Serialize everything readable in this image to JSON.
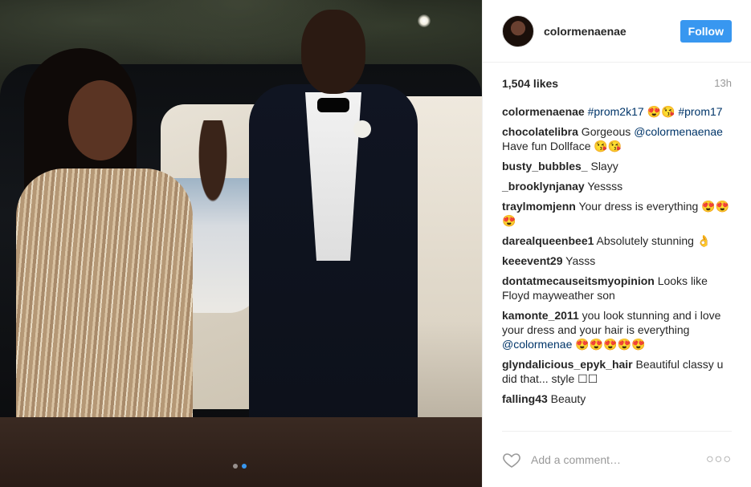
{
  "post": {
    "username": "colormenaenae",
    "follow_label": "Follow",
    "likes": "1,504 likes",
    "time": "13h",
    "carousel": {
      "count": 2,
      "active": 1
    }
  },
  "comments": [
    {
      "user": "colormenaenae",
      "parts": [
        {
          "t": " "
        },
        {
          "t": "#prom2k17",
          "tag": true
        },
        {
          "t": " 😍😘 "
        },
        {
          "t": "#prom17",
          "tag": true
        }
      ]
    },
    {
      "user": "chocolatelibra",
      "parts": [
        {
          "t": " Gorgeous "
        },
        {
          "t": "@colormenaenae",
          "tag": true
        },
        {
          "t": " Have fun Dollface 😘😘"
        }
      ]
    },
    {
      "user": "busty_bubbles_",
      "parts": [
        {
          "t": " Slayy"
        }
      ]
    },
    {
      "user": "_brooklynjanay",
      "parts": [
        {
          "t": " Yessss"
        }
      ]
    },
    {
      "user": "traylmomjenn",
      "parts": [
        {
          "t": " Your dress is everything 😍😍😍"
        }
      ]
    },
    {
      "user": "darealqueenbee1",
      "parts": [
        {
          "t": " Absolutely stunning 👌"
        }
      ]
    },
    {
      "user": "keeevent29",
      "parts": [
        {
          "t": " Yasss"
        }
      ]
    },
    {
      "user": "dontatmecauseitsmyopinion",
      "parts": [
        {
          "t": " Looks like Floyd mayweather son"
        }
      ]
    },
    {
      "user": "kamonte_2011",
      "parts": [
        {
          "t": " you look stunning and i love your dress and your hair is everything "
        },
        {
          "t": "@colormenae",
          "tag": true
        },
        {
          "t": " 😍😍😍😍😍"
        }
      ]
    },
    {
      "user": "glyndalicious_epyk_hair",
      "parts": [
        {
          "t": " Beautiful classy u did that... style ☐☐"
        }
      ]
    },
    {
      "user": "falling43",
      "parts": [
        {
          "t": " Beauty"
        }
      ]
    }
  ],
  "footer": {
    "add_comment_placeholder": "Add a comment…",
    "more_label": "○○○"
  },
  "icons": {
    "heart": "heart-icon",
    "more": "more-options-icon"
  },
  "colors": {
    "accent": "#3897f0",
    "hashtag": "#003569"
  }
}
